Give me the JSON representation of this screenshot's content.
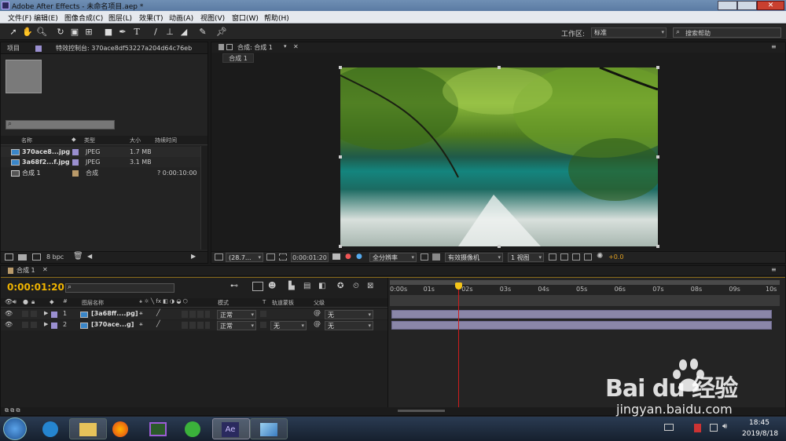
{
  "window": {
    "title": "Adobe After Effects - 未命名项目.aep *",
    "logo": "Ae"
  },
  "menu": [
    "文件(F)",
    "编辑(E)",
    "图像合成(C)",
    "图层(L)",
    "效果(T)",
    "动画(A)",
    "视图(V)",
    "窗口(W)",
    "帮助(H)"
  ],
  "toolbar": {
    "workspace_label": "工作区:",
    "workspace_value": "标准",
    "search_placeholder": "搜索帮助"
  },
  "project_panel": {
    "tab_project": "项目",
    "tab_effects": "特效控制台: 370ace8df53227a204d64c76eb",
    "columns": [
      "名称",
      "类型",
      "大小",
      "持续时间"
    ],
    "items": [
      {
        "name": "370ace8...jpg",
        "type": "JPEG",
        "size": "1.7 MB",
        "duration": "",
        "color": "#9a8fd0"
      },
      {
        "name": "3a68f2...f.jpg",
        "type": "JPEG",
        "size": "3.1 MB",
        "duration": "",
        "color": "#9a8fd0"
      },
      {
        "name": "合成 1",
        "type": "合成",
        "size": "",
        "duration": "? 0:00:10:00",
        "color": "#b99a6a"
      }
    ],
    "bpc": "8 bpc"
  },
  "comp_panel": {
    "tab": "合成: 合成 1",
    "subtab": "合成 1",
    "zoom": "(28.7...",
    "timecode": "0:00:01:20",
    "resolution": "全分辨率",
    "camera": "有效摄像机",
    "views": "1 视图",
    "exposure": "+0.0"
  },
  "timeline": {
    "tab": "合成 1",
    "timecode": "0:00:01:20",
    "col_layer_name": "图层名称",
    "col_mode": "模式",
    "col_t": "T",
    "col_trkmat": "轨道蒙板",
    "col_parent": "父级",
    "layers": [
      {
        "num": "1",
        "name": "[3a68ff....pg]",
        "mode": "正常",
        "trkmat": "",
        "parent": "无"
      },
      {
        "num": "2",
        "name": "[370ace...g]",
        "mode": "正常",
        "trkmat": "无",
        "parent": "无"
      }
    ],
    "ruler": [
      "0:00s",
      "01s",
      "02s",
      "03s",
      "04s",
      "05s",
      "06s",
      "07s",
      "08s",
      "09s",
      "10s"
    ],
    "playhead_seconds": 1.8
  },
  "taskbar": {
    "time": "18:45",
    "date": "2019/8/18"
  },
  "watermark": {
    "brand": "Bai du 经验",
    "url": "jingyan.baidu.com"
  },
  "colors": {
    "timecode": "#f0b400",
    "playhead": "#d01c1c",
    "layer_bar": "#8a86a8",
    "accent": "#f5c518"
  }
}
